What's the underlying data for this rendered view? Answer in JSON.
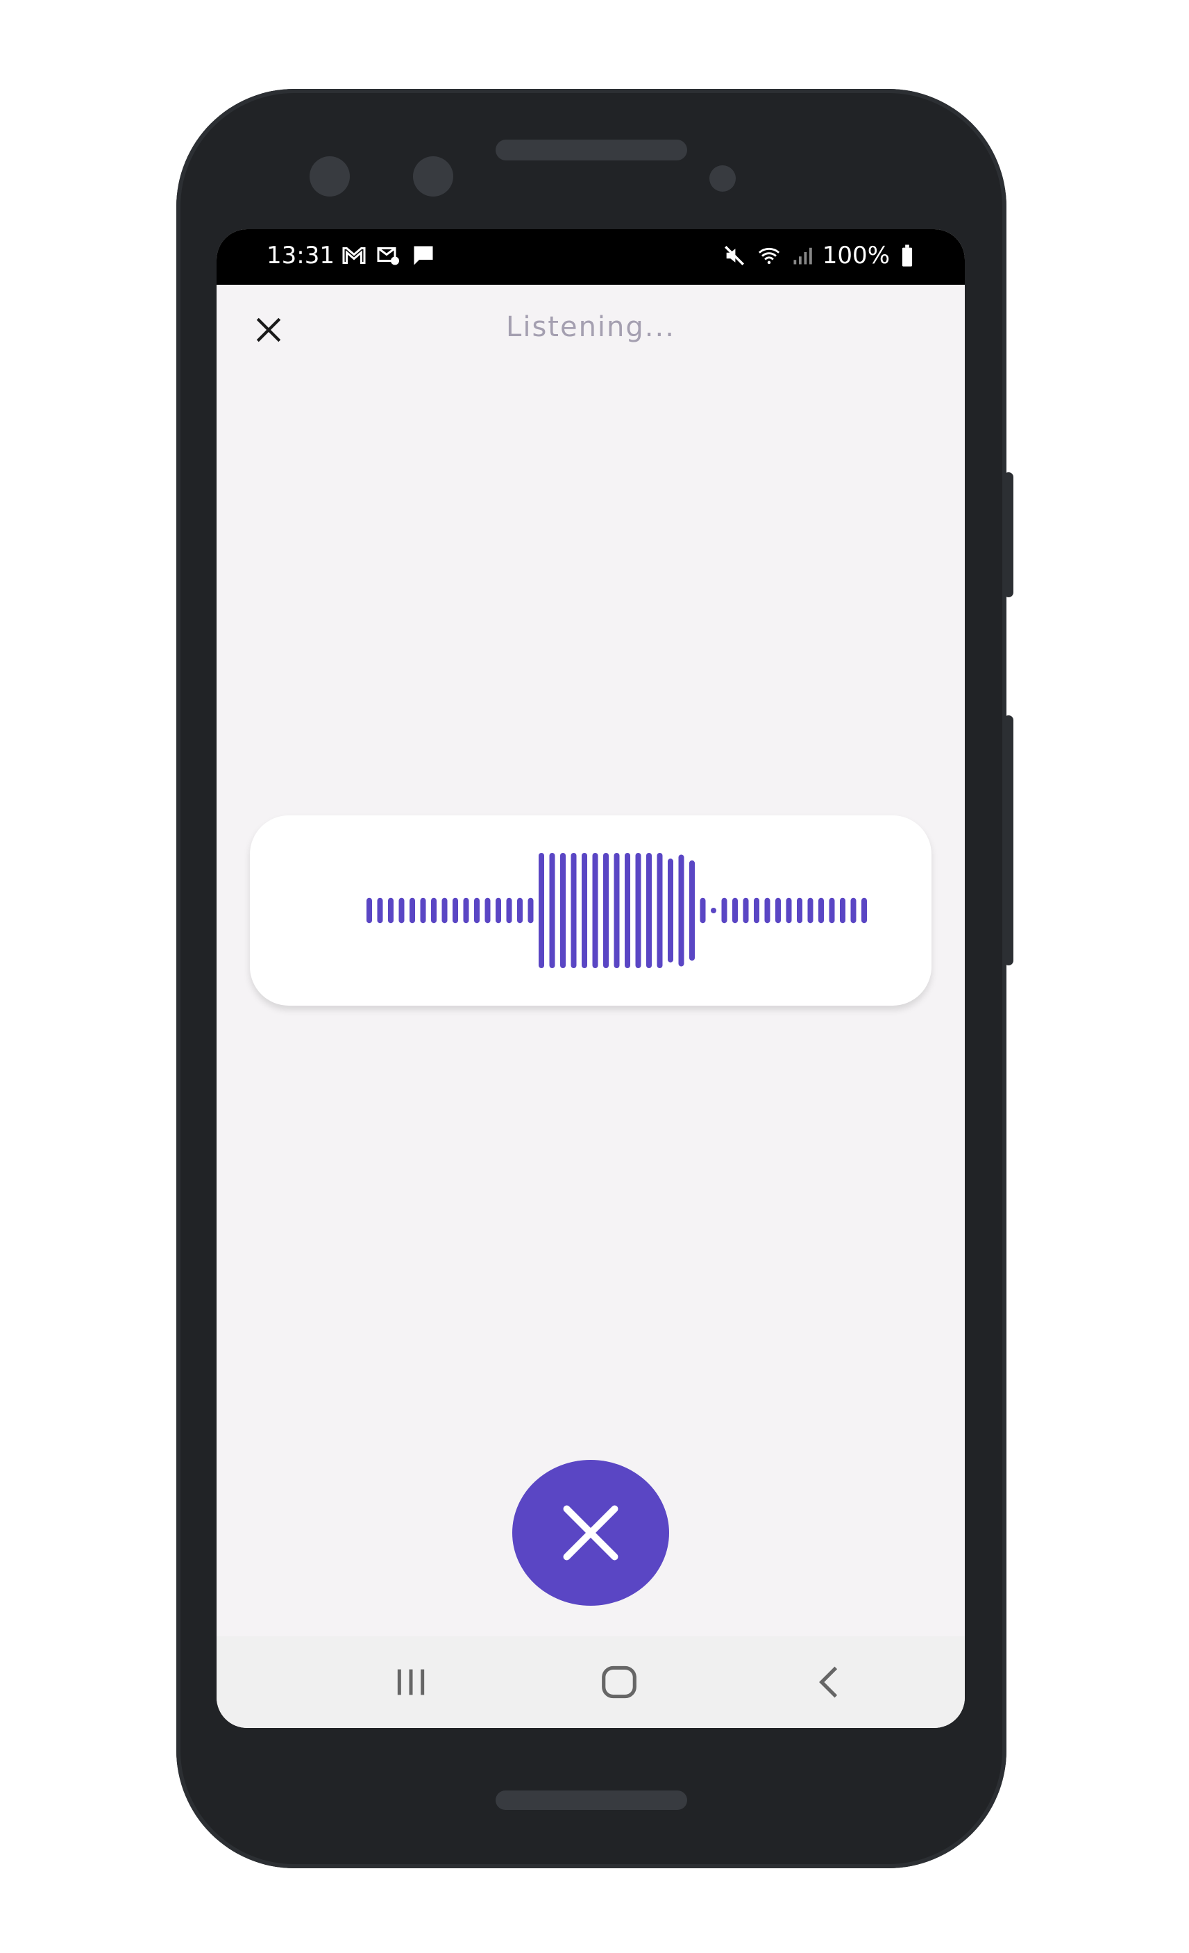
{
  "status_bar": {
    "time": "13:31",
    "battery_percent": "100%",
    "left_icons": [
      "gmail-icon",
      "mail-settings-icon",
      "chat-icon"
    ],
    "right_icons": [
      "mute-icon",
      "wifi-icon",
      "signal-icon",
      "battery-icon"
    ]
  },
  "header": {
    "title": "Listening...",
    "close_icon": "close-icon"
  },
  "waveform": {
    "color": "#5a46c4",
    "levels": [
      0.22,
      0.22,
      0.22,
      0.22,
      0.22,
      0.22,
      0.22,
      0.22,
      0.22,
      0.22,
      0.22,
      0.22,
      0.22,
      0.22,
      0.22,
      0.22,
      1.0,
      1.0,
      1.0,
      1.0,
      1.0,
      1.0,
      1.0,
      1.0,
      1.0,
      1.0,
      1.0,
      1.0,
      0.9,
      0.97,
      0.87,
      0.22,
      0.04,
      0.22,
      0.22,
      0.22,
      0.22,
      0.22,
      0.22,
      0.22,
      0.22,
      0.22,
      0.22,
      0.22,
      0.22,
      0.22,
      0.22
    ]
  },
  "cancel_button": {
    "icon": "close-icon",
    "color": "#5a46c4"
  },
  "nav_bar": {
    "items": [
      "recent-apps-icon",
      "home-icon",
      "back-icon"
    ]
  }
}
